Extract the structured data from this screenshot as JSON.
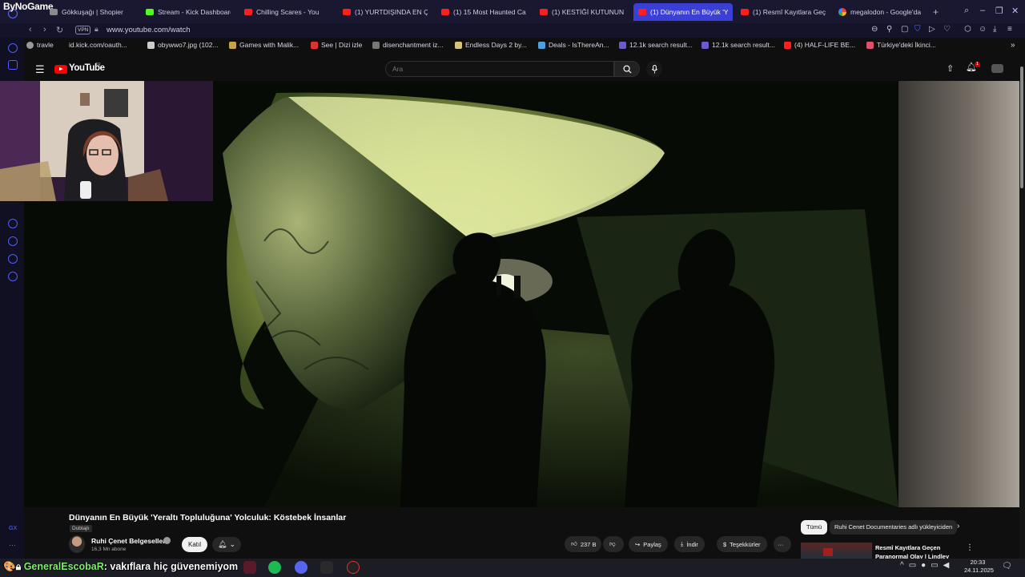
{
  "overlay": {
    "brand": "ByNoGame"
  },
  "browser": {
    "tabs": [
      {
        "label": "Gökkuşağı | Shopier",
        "icon": "shopier-icon"
      },
      {
        "label": "Stream - Kick Dashboard",
        "icon": "kick-icon"
      },
      {
        "label": "Chilling Scares - You",
        "icon": "youtube-icon"
      },
      {
        "label": "(1) YURTDIŞINDA EN ÇOK",
        "icon": "youtube-icon"
      },
      {
        "label": "(1) 15 Most Haunted Cas",
        "icon": "youtube-icon"
      },
      {
        "label": "(1) KESTİĞİ KUTUNUN İ",
        "icon": "youtube-icon"
      },
      {
        "label": "(1) Dünyanın En Büyük 'Y",
        "icon": "youtube-icon",
        "active": true
      },
      {
        "label": "(1) Resmî Kayıtlara Geçe",
        "icon": "youtube-icon"
      },
      {
        "label": "megalodon - Google'da",
        "icon": "google-icon"
      }
    ],
    "new_tab": "+",
    "vpn": "VPN",
    "url": "www.youtube.com/watch"
  },
  "bookmarks": [
    "travle",
    "id.kick.com/oauth...",
    "obywwo7.jpg (102...",
    "Games with Malik...",
    "See | Dizi izle",
    "disenchantment iz...",
    "Endless Days 2 by...",
    "Deals - IsThereAn...",
    "12.1k search result...",
    "12.1k search result...",
    "(4) HALF-LIFE BE...",
    "Türkiye'deki İkinci..."
  ],
  "youtube": {
    "logo": "YouTube",
    "country": "TR",
    "search_placeholder": "Ara",
    "notifications": "1"
  },
  "video": {
    "title": "Dünyanın En Büyük 'Yeraltı Topluluğuna' Yolculuk: Köstebek İnsanlar",
    "dub_badge": "Dublajlı",
    "channel": "Ruhi Çenet Belgeselleri",
    "subscribers": "16,3 Mn abone",
    "join": "Katıl",
    "likes": "237 B",
    "share": "Paylaş",
    "download": "İndir",
    "thanks": "Teşekkürler",
    "more": "···"
  },
  "sidebar_panel": {
    "chips": [
      "Tümü",
      "Ruhi Cenet Documentaries adlı yükleyiciden"
    ],
    "recommended_title": "Resmî Kayıtlara Geçen Paranormal Olay | Lindley Stre..."
  },
  "taskbar": {
    "chat_user": "GeneralEscobaR",
    "chat_message": ": vakıflara hiç güvenemiyom",
    "time": "20:33",
    "date": "24.11.2025"
  },
  "colors": {
    "accent": "#3b3fd6",
    "youtube_red": "#ff0000",
    "tunnel_light": "#d9e86a"
  }
}
